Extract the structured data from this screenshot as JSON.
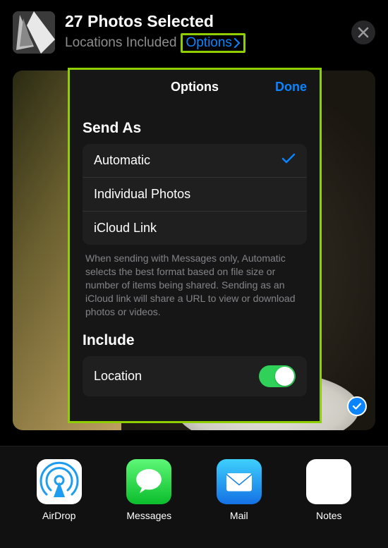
{
  "header": {
    "title": "27 Photos Selected",
    "subtitle": "Locations Included",
    "options_link": "Options"
  },
  "panel": {
    "title": "Options",
    "done": "Done",
    "send_as_header": "Send As",
    "send_as_options": [
      "Automatic",
      "Individual Photos",
      "iCloud Link"
    ],
    "send_as_selected_index": 0,
    "footer": "When sending with Messages only, Automatic selects the best format based on file size or number of items being shared. Sending as an iCloud link will share a URL to view or download photos or videos.",
    "include_header": "Include",
    "include_item": "Location",
    "include_toggle_on": true
  },
  "share": {
    "items": [
      "AirDrop",
      "Messages",
      "Mail",
      "Notes"
    ]
  },
  "colors": {
    "accent": "#0a84ff",
    "highlight_border": "#8fce00",
    "toggle_on": "#30d158"
  }
}
